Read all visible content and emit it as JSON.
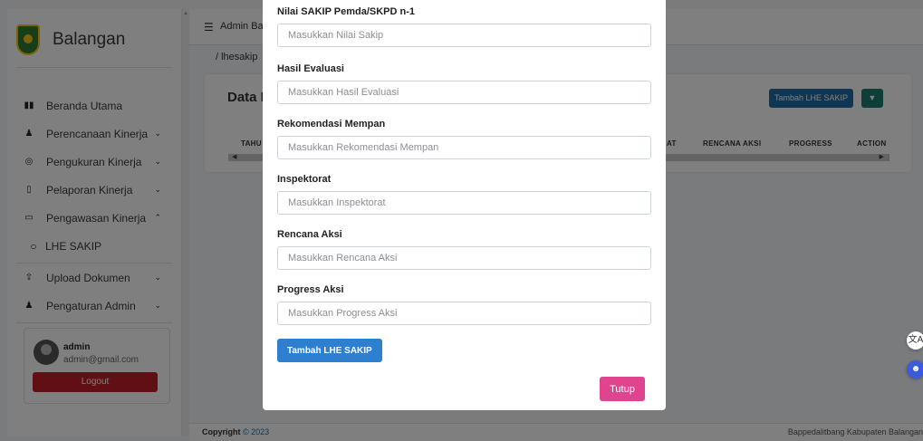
{
  "sidebar": {
    "brand": "Balangan",
    "items": [
      {
        "label": "Beranda Utama",
        "icon": "dashboard-icon"
      },
      {
        "label": "Perencanaan Kinerja",
        "icon": "users-icon"
      },
      {
        "label": "Pengukuran Kinerja",
        "icon": "target-icon"
      },
      {
        "label": "Pelaporan Kinerja",
        "icon": "file-icon"
      },
      {
        "label": "Pengawasan Kinerja",
        "icon": "monitor-icon"
      },
      {
        "label": "LHE SAKIP",
        "icon": "circle-icon"
      },
      {
        "label": "Upload Dokumen",
        "icon": "upload-icon"
      },
      {
        "label": "Pengaturan Admin",
        "icon": "users-cog-icon"
      }
    ],
    "user": {
      "name": "admin",
      "email": "admin@gmail.com",
      "logout": "Logout"
    }
  },
  "topbar": {
    "title": "Admin Ba"
  },
  "breadcrumb": "/ lhesakip",
  "card": {
    "title": "Data L",
    "add_button": "Tambah LHE SAKIP",
    "headers": {
      "tahun": "TAHU",
      "inspektorat": "AT",
      "rencana": "RENCANA AKSI",
      "progress": "PROGRESS",
      "action": "ACTION"
    }
  },
  "footer": {
    "copyright": "Copyright",
    "year": "© 2023",
    "right": "Bappedalitbang Kabupaten Balangan"
  },
  "modal": {
    "fields": [
      {
        "label": "Nilai SAKIP Pemda/SKPD n-1",
        "placeholder": "Masukkan Nilai Sakip"
      },
      {
        "label": "Hasil Evaluasi",
        "placeholder": "Masukkan Hasil Evaluasi"
      },
      {
        "label": "Rekomendasi Mempan",
        "placeholder": "Masukkan Rekomendasi Mempan"
      },
      {
        "label": "Inspektorat",
        "placeholder": "Masukkan Inspektorat"
      },
      {
        "label": "Rencana Aksi",
        "placeholder": "Masukkan Rencana Aksi"
      },
      {
        "label": "Progress Aksi",
        "placeholder": "Masukkan Progress Aksi"
      }
    ],
    "submit": "Tambah LHE SAKIP",
    "close": "Tutup"
  },
  "colors": {
    "primary": "#2f7fd1",
    "danger": "#c0202b",
    "pink": "#e0448e",
    "teal": "#1b7d6e"
  }
}
